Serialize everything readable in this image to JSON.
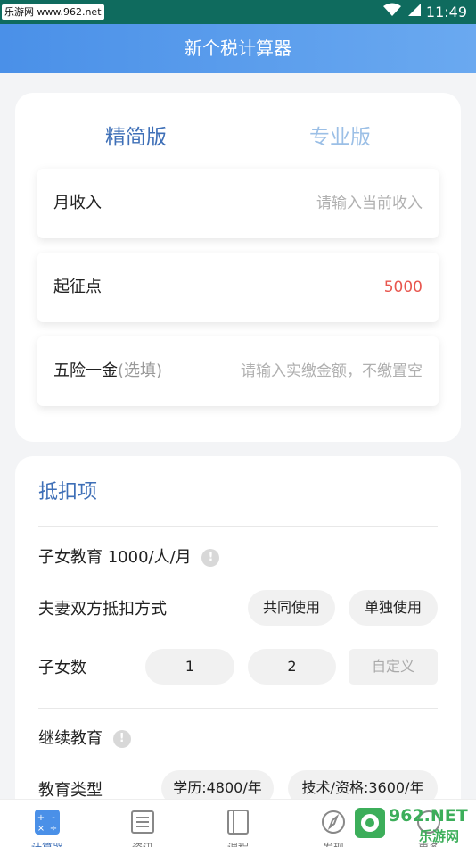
{
  "statusbar": {
    "watermark": "乐游网 www.962.net",
    "time": "11:49"
  },
  "header": {
    "title": "新个税计算器"
  },
  "tabs": {
    "simple": "精简版",
    "pro": "专业版"
  },
  "form": {
    "income": {
      "label": "月收入",
      "placeholder": "请输入当前收入"
    },
    "threshold": {
      "label": "起征点",
      "value": "5000"
    },
    "insurance": {
      "label": "五险一金",
      "optional": "(选填)",
      "placeholder": "请输入实缴金额，不缴置空"
    }
  },
  "deductions": {
    "title": "抵扣项",
    "children_edu": "子女教育 1000/人/月",
    "info": "!",
    "couple_label": "夫妻双方抵扣方式",
    "couple_options": [
      "共同使用",
      "单独使用"
    ],
    "children_count_label": "子女数",
    "children_count_options": [
      "1",
      "2",
      "自定义"
    ],
    "continuing_edu": "继续教育",
    "edu_type_label": "教育类型",
    "edu_type_options": [
      "学历:4800/年",
      "技术/资格:3600/年"
    ]
  },
  "tabbar": {
    "items": [
      "计算器",
      "资讯",
      "课程",
      "发现",
      "更多"
    ]
  },
  "watermark2": {
    "brand": "962.NET",
    "sub": "乐游网"
  },
  "colors": {
    "accent": "#3e6fb7",
    "header": "#4a90e8",
    "threshold": "#e8574f"
  }
}
